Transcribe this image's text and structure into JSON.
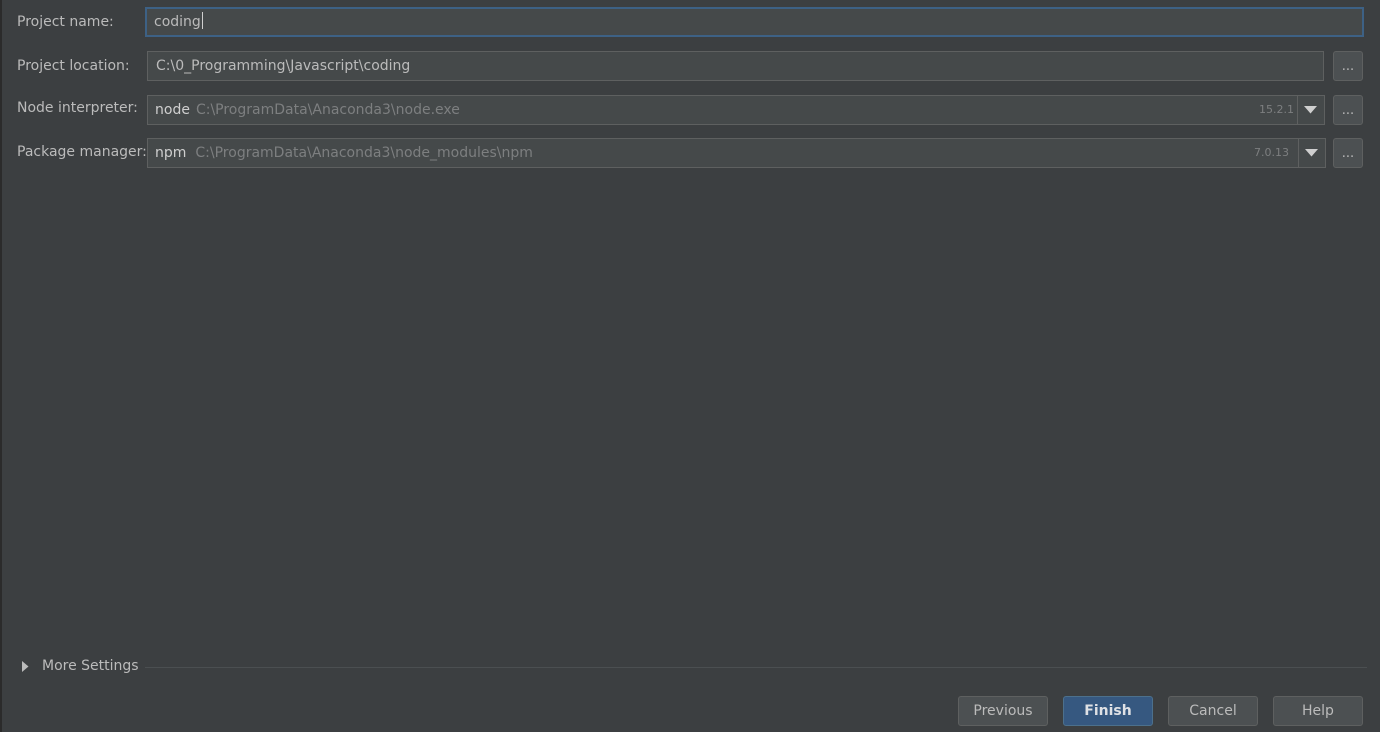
{
  "form": {
    "project_name": {
      "label": "Project name:",
      "value": "coding"
    },
    "project_location": {
      "label": "Project location:",
      "value": "C:\\0_Programming\\Javascript\\coding",
      "browse_label": "..."
    },
    "node_interpreter": {
      "label": "Node interpreter:",
      "name": "node",
      "path": "C:\\ProgramData\\Anaconda3\\node.exe",
      "version": "15.2.1",
      "browse_label": "..."
    },
    "package_manager": {
      "label": "Package manager:",
      "name": "npm",
      "path": "C:\\ProgramData\\Anaconda3\\node_modules\\npm",
      "version": "7.0.13",
      "browse_label": "..."
    }
  },
  "more_settings": {
    "label": "More Settings",
    "expanded": false
  },
  "buttons": {
    "previous": "Previous",
    "finish": "Finish",
    "cancel": "Cancel",
    "help": "Help"
  },
  "colors": {
    "background": "#3c3f41",
    "field": "#45494a",
    "focus_border": "#3d6185",
    "primary_button": "#365880"
  }
}
